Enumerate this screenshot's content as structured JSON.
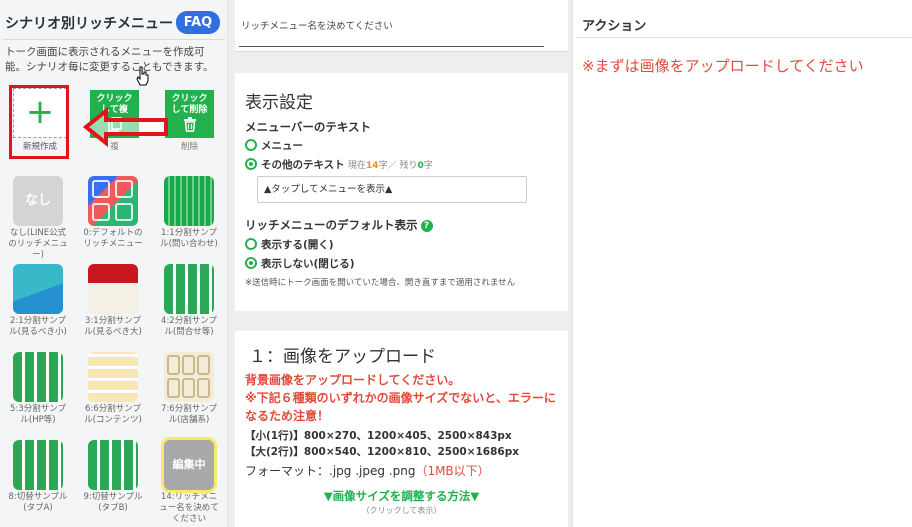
{
  "left": {
    "title": "シナリオ別リッチメニュー",
    "faq_label": "FAQ",
    "description": "トーク画面に表示されるメニューを作成可能。シナリオ毎に変更することもできます。",
    "new_label": "新規作成",
    "copy_tile": {
      "line1": "クリック",
      "line2": "して複",
      "caption": "複"
    },
    "delete_tile": {
      "line1": "クリック",
      "line2": "して削除",
      "caption": "削除"
    },
    "templates": [
      {
        "thumb": "なし",
        "caption": "なし(LINE公式のリッチメニュー)"
      },
      {
        "thumb": "",
        "caption": "0:デフォルトのリッチメニュー"
      },
      {
        "thumb": "",
        "caption": "1:1分割サンプル(問い合わせ)"
      },
      {
        "thumb": "",
        "caption": "2:1分割サンプル(見るべき小)"
      },
      {
        "thumb": "",
        "caption": "3:1分割サンプル(見るべき大)"
      },
      {
        "thumb": "",
        "caption": "4:2分割サンプル(問合せ等)"
      },
      {
        "thumb": "",
        "caption": "5:3分割サンプル(HP等)"
      },
      {
        "thumb": "",
        "caption": "6:6分割サンプル(コンテンツ)"
      },
      {
        "thumb": "",
        "caption": "7:6分割サンプル(店舗系)"
      },
      {
        "thumb": "",
        "caption": "8:切替サンプル(タブA)"
      },
      {
        "thumb": "",
        "caption": "9:切替サンプル(タブB)"
      },
      {
        "thumb": "編集中",
        "caption": "14:リッチメニュー名を決めてください"
      }
    ]
  },
  "name_section": {
    "value": "リッチメニュー名を決めてください"
  },
  "display": {
    "heading": "表示設定",
    "menubar_heading": "メニューバーのテキスト",
    "option_menu": "メニュー",
    "option_other": "その他のテキスト",
    "counter_now": "現在",
    "counter_now_value": "14",
    "counter_mid": "字／ 残り",
    "counter_left_value": "0",
    "counter_end": "字",
    "menu_text_value": "▲タップしてメニューを表示▲",
    "default_heading": "リッチメニューのデフォルト表示",
    "help_icon": "?",
    "option_show": "表示する(開く)",
    "option_hide": "表示しない(閉じる)",
    "note": "※送信時にトーク画面を開いていた場合、開き直すまで適用されません"
  },
  "upload": {
    "heading": "１：画像をアップロード",
    "warn1": "背景画像をアップロードしてください。",
    "warn2": "※下記６種類のいずれかの画像サイズでないと、エラーになるため注意！",
    "size_small": "【小(1行)】800×270、1200×405、2500×843px",
    "size_large": "【大(2行)】800×540、1200×810、2500×1686px",
    "format_label": "フォーマット：.jpg .jpeg .png",
    "format_limit": "（1MB以下）",
    "adjust_link": "▼画像サイズを調整する方法▼",
    "adjust_sub": "（クリックして表示）"
  },
  "action": {
    "title": "アクション",
    "message": "※まずは画像をアップロードしてください"
  },
  "colors": {
    "accent_green": "#22b14c",
    "faq_blue": "#2f6fe0",
    "warning_red": "#e24a3b",
    "highlight_red": "#e0151b",
    "counter_orange": "#f08a1c"
  },
  "icons": [
    "plus-icon",
    "copy-icon",
    "trash-icon",
    "help-icon",
    "arrow-left-icon",
    "hand-cursor-icon"
  ]
}
